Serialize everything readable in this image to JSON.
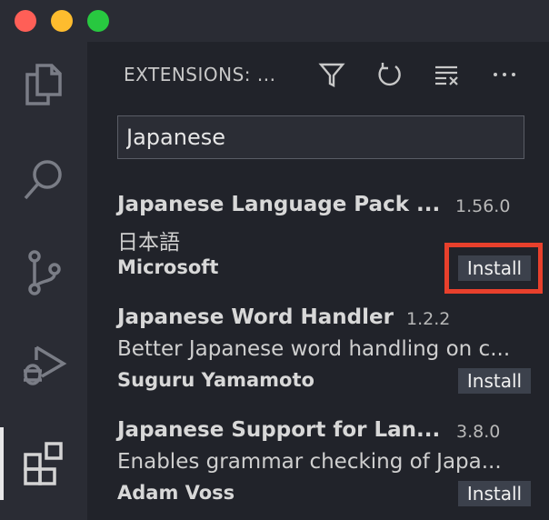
{
  "titlebar": {
    "lights": [
      {
        "name": "close",
        "color": "#ff5f57"
      },
      {
        "name": "minimize",
        "color": "#febc2e"
      },
      {
        "name": "maximize",
        "color": "#28c840"
      }
    ]
  },
  "activity_bar": {
    "items": [
      {
        "icon": "files-icon"
      },
      {
        "icon": "search-icon"
      },
      {
        "icon": "source-control-icon"
      },
      {
        "icon": "run-debug-icon"
      },
      {
        "icon": "extensions-icon",
        "active": true
      }
    ]
  },
  "sidebar": {
    "title": "EXTENSIONS: ...",
    "actions": [
      {
        "icon": "filter-icon"
      },
      {
        "icon": "refresh-icon"
      },
      {
        "icon": "clear-results-icon"
      },
      {
        "icon": "more-icon"
      }
    ],
    "search": {
      "value": "Japanese"
    }
  },
  "extensions": [
    {
      "name": "Japanese Language Pack ...",
      "version": "1.56.0",
      "description": "日本語",
      "publisher": "Microsoft",
      "install_label": "Install"
    },
    {
      "name": "Japanese Word Handler",
      "version": "1.2.2",
      "description": "Better Japanese word handling on c...",
      "publisher": "Suguru Yamamoto",
      "install_label": "Install"
    },
    {
      "name": "Japanese Support for Lan...",
      "version": "3.8.0",
      "description": "Enables grammar checking of Japa...",
      "publisher": "Adam Voss",
      "install_label": "Install"
    }
  ],
  "colors": {
    "highlight": "#e8402c",
    "accent_active": "#e8e8e8"
  }
}
